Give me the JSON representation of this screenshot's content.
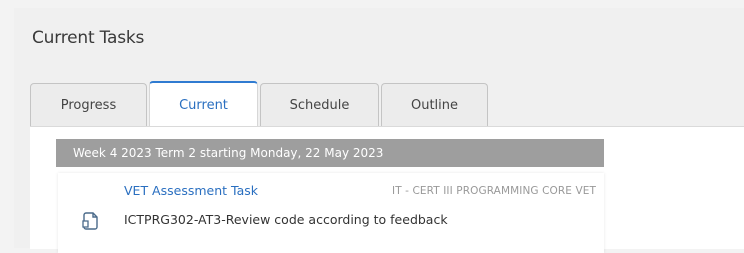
{
  "panel": {
    "title": "Current Tasks"
  },
  "tabs": [
    {
      "label": "Progress",
      "active": false
    },
    {
      "label": "Current",
      "active": true
    },
    {
      "label": "Schedule",
      "active": false
    },
    {
      "label": "Outline",
      "active": false
    }
  ],
  "week": {
    "label": "Week 4 2023 Term 2 starting Monday, 22 May 2023"
  },
  "task": {
    "title": "VET Assessment Task",
    "course": "IT - CERT III PROGRAMMING CORE VET",
    "description": "ICTPRG302-AT3-Review code according to feedback",
    "icon": "document-icon"
  },
  "colors": {
    "accent": "#2f7bd1",
    "week_bar": "#9e9e9e"
  }
}
